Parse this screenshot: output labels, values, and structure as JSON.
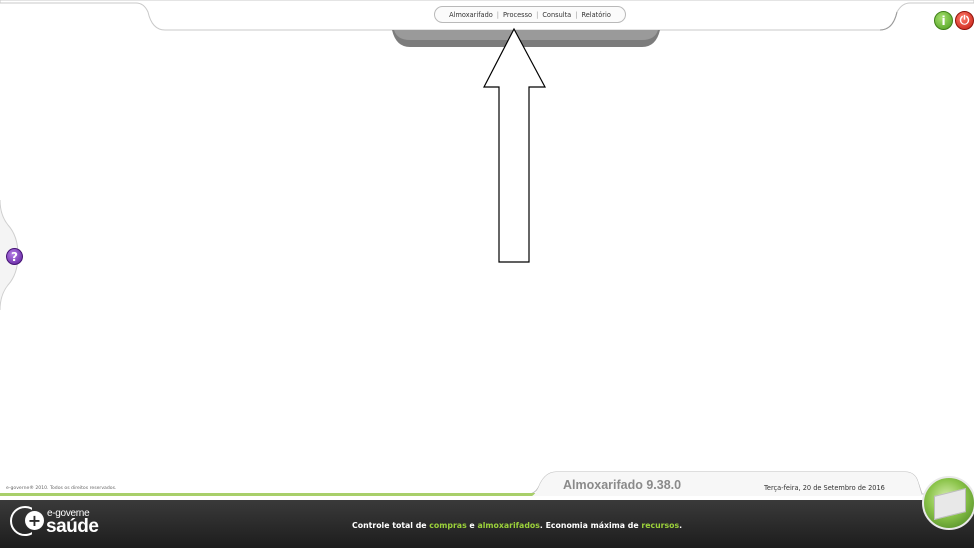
{
  "menu": {
    "items": [
      "Almoxarifado",
      "Processo",
      "Consulta",
      "Relatório"
    ]
  },
  "top_icons": {
    "info_glyph": "i",
    "power_glyph": "⏻"
  },
  "help": {
    "glyph": "?"
  },
  "footer": {
    "copyright": "e-governe® 2010. Todos os direitos reservados.",
    "version": "Almoxarifado 9.38.0",
    "date": "Terça-feira, 20 de Setembro de 2016",
    "logo_line1": "e-governe",
    "logo_line2": "saúde",
    "tagline_parts": {
      "p1": "Controle total de ",
      "p2": "compras",
      "p3": " e ",
      "p4": "almoxarifados",
      "p5": ". Economia máxima de ",
      "p6": "recursos",
      "p7": "."
    }
  },
  "colors": {
    "highlight": "#9bd13a",
    "footer_bg": "#2a2a2a",
    "info": "#4a9c1c",
    "power": "#c31a10",
    "help": "#5b1c9a"
  }
}
